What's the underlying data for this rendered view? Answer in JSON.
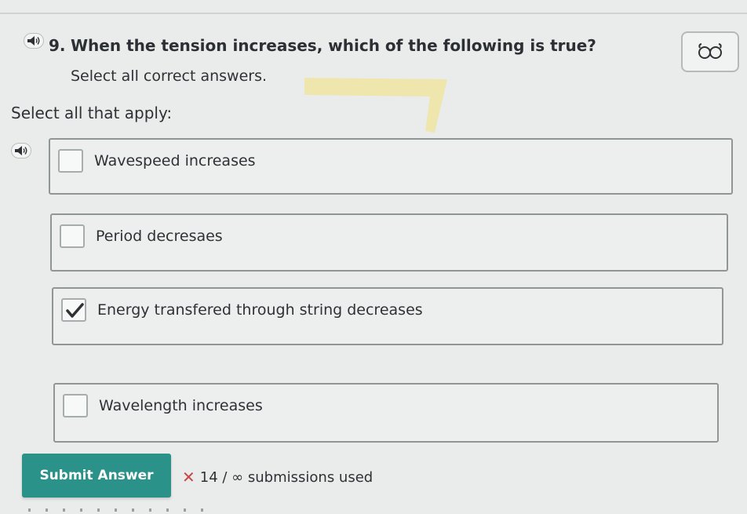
{
  "question": {
    "number": "9.",
    "text": "When the tension increases, which of the following is true?",
    "subtext": "Select all correct answers."
  },
  "instructions": "Select all that apply:",
  "options": [
    {
      "label": "Wavespeed increases",
      "checked": false
    },
    {
      "label": "Period decresaes",
      "checked": false
    },
    {
      "label": "Energy transfered through string decreases",
      "checked": true
    },
    {
      "label": "Wavelength increases",
      "checked": false
    }
  ],
  "submit": {
    "label": "Submit Answer"
  },
  "submissions": {
    "used": "14",
    "total": "∞",
    "text": "14 / ∞ submissions used"
  },
  "icons": {
    "audio": "speaker-icon",
    "hint": "glasses-icon",
    "check": "checkmark-icon",
    "incorrect": "x-mark-icon"
  },
  "colors": {
    "submit_bg": "#2a9288",
    "highlight": "#f4e27a",
    "incorrect": "#c84545"
  }
}
